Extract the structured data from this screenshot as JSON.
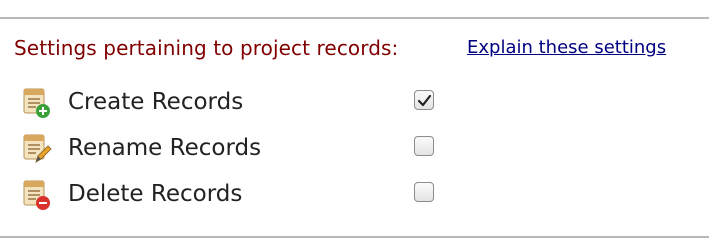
{
  "section": {
    "header": "Settings pertaining to project records:",
    "explain_link": "Explain these settings"
  },
  "rows": [
    {
      "label": "Create Records",
      "checked": true,
      "icon": "document-add-icon",
      "badge_color": "#3aa13a"
    },
    {
      "label": "Rename Records",
      "checked": false,
      "icon": "document-edit-icon",
      "badge_color": "#e8a42a"
    },
    {
      "label": "Delete Records",
      "checked": false,
      "icon": "document-delete-icon",
      "badge_color": "#d9332b"
    }
  ],
  "colors": {
    "header_text": "#800000",
    "link_text": "#000080",
    "label_text": "#222222",
    "rule": "#b8b8b8"
  }
}
